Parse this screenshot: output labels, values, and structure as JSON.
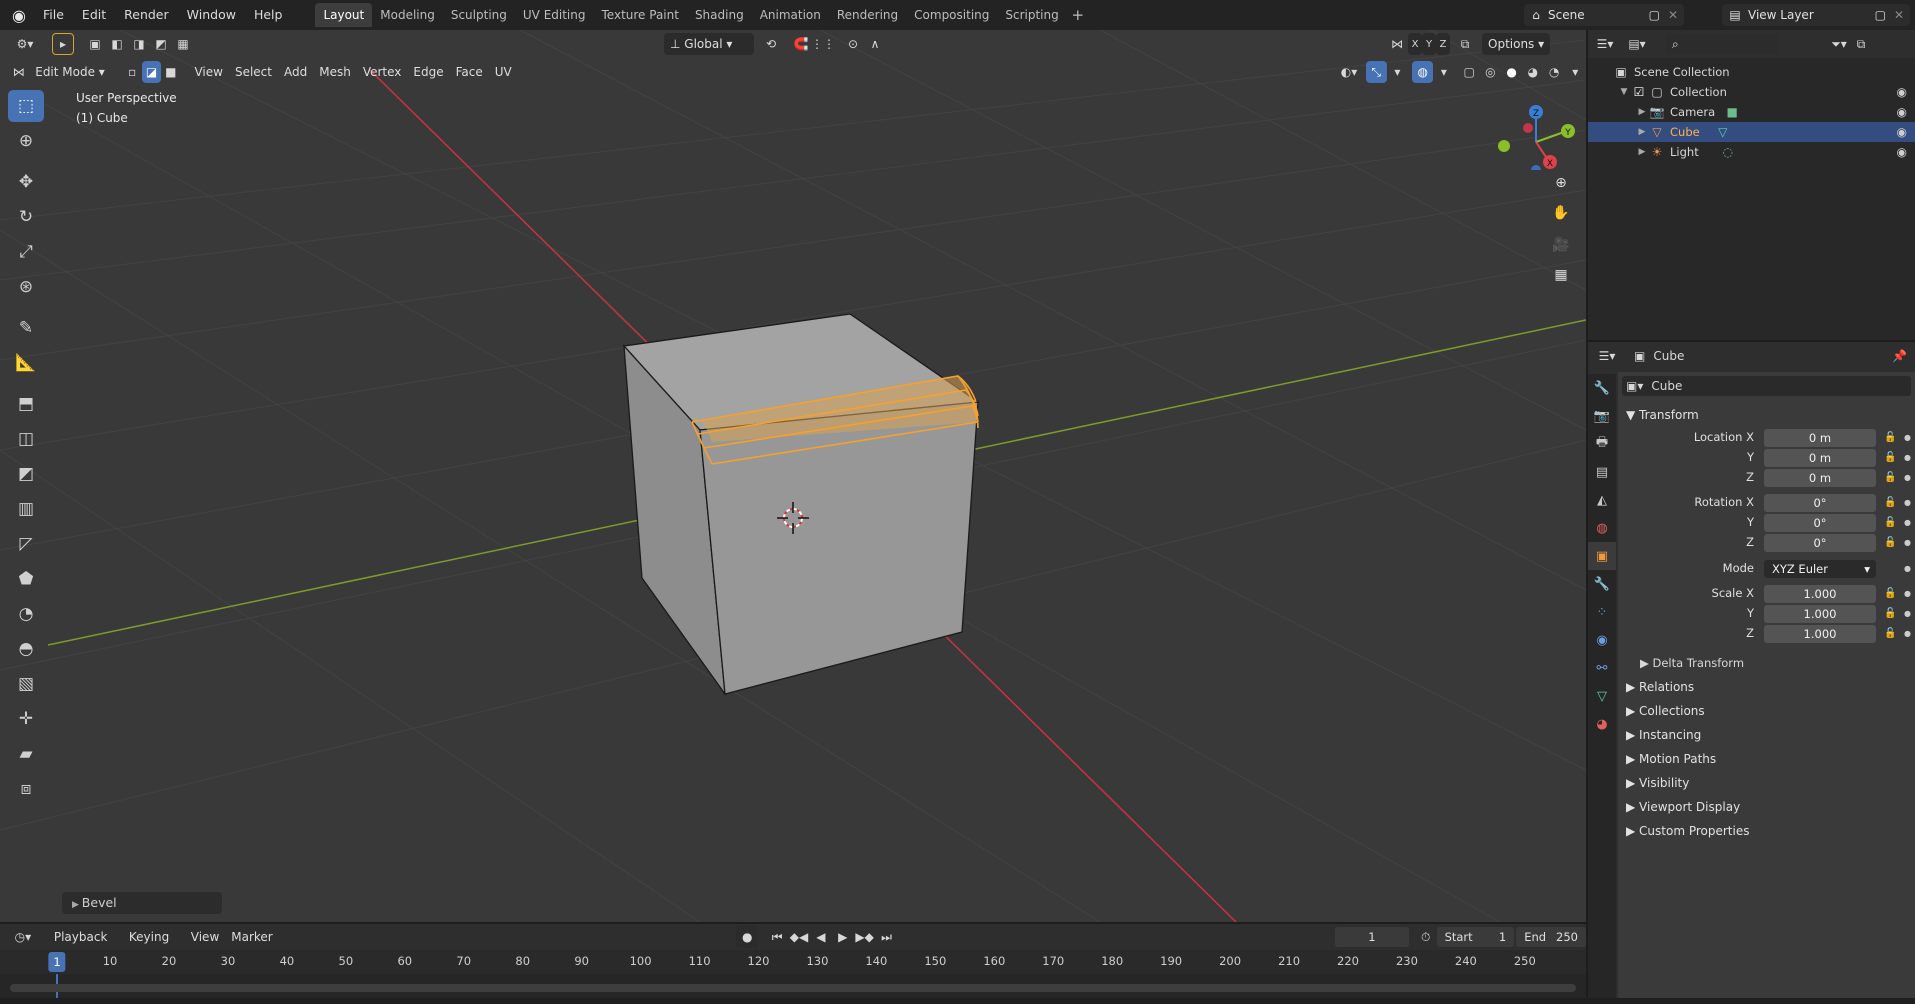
{
  "topbar": {
    "menus": [
      "File",
      "Edit",
      "Render",
      "Window",
      "Help"
    ],
    "workspace_tabs": [
      "Layout",
      "Modeling",
      "Sculpting",
      "UV Editing",
      "Texture Paint",
      "Shading",
      "Animation",
      "Rendering",
      "Compositing",
      "Scripting"
    ],
    "active_tab": "Layout",
    "scene_name": "Scene",
    "view_layer_name": "View Layer"
  },
  "viewport_header": {
    "mode": "Edit Mode",
    "menus": [
      "View",
      "Select",
      "Add",
      "Mesh",
      "Vertex",
      "Edge",
      "Face",
      "UV"
    ],
    "transform_orientation": "Global",
    "options_label": "Options",
    "axis_labels": [
      "X",
      "Y",
      "Z"
    ]
  },
  "viewport": {
    "view_name": "User Perspective",
    "object_info": "(1) Cube",
    "last_operator": "Bevel",
    "colors": {
      "background": "#393939",
      "grid": "#454545",
      "x_axis": "#c6343f",
      "y_axis": "#7e9c2b",
      "face": "#9a9a9a",
      "selection": "#f6a12c"
    }
  },
  "gizmo": {
    "x_label": "X",
    "y_label": "Y",
    "z_label": "Z"
  },
  "outliner": {
    "root": "Scene Collection",
    "collection": "Collection",
    "items": [
      {
        "name": "Camera",
        "icon": "camera-icon",
        "selected": false
      },
      {
        "name": "Cube",
        "icon": "mesh-icon",
        "selected": true
      },
      {
        "name": "Light",
        "icon": "light-icon",
        "selected": false
      }
    ]
  },
  "properties": {
    "header_object": "Cube",
    "object_name": "Cube",
    "transform_label": "Transform",
    "location_label": "Location X",
    "rotation_label": "Rotation X",
    "scale_label": "Scale X",
    "mode_label": "Mode",
    "y_label": "Y",
    "z_label": "Z",
    "location": [
      "0 m",
      "0 m",
      "0 m"
    ],
    "rotation": [
      "0°",
      "0°",
      "0°"
    ],
    "rotation_mode": "XYZ Euler",
    "scale": [
      "1.000",
      "1.000",
      "1.000"
    ],
    "delta_transform": "Delta Transform",
    "panels": [
      "Relations",
      "Collections",
      "Instancing",
      "Motion Paths",
      "Visibility",
      "Viewport Display",
      "Custom Properties"
    ]
  },
  "timeline": {
    "menus": [
      "Playback",
      "Keying",
      "View",
      "Marker"
    ],
    "current_frame": "1",
    "start_label": "Start",
    "start": "1",
    "end_label": "End",
    "end": "250",
    "ruler_ticks": [
      "10",
      "20",
      "30",
      "40",
      "50",
      "60",
      "70",
      "80",
      "90",
      "100",
      "110",
      "120",
      "130",
      "140",
      "150",
      "160",
      "170",
      "180",
      "190",
      "200",
      "210",
      "220",
      "230",
      "240",
      "250"
    ]
  }
}
